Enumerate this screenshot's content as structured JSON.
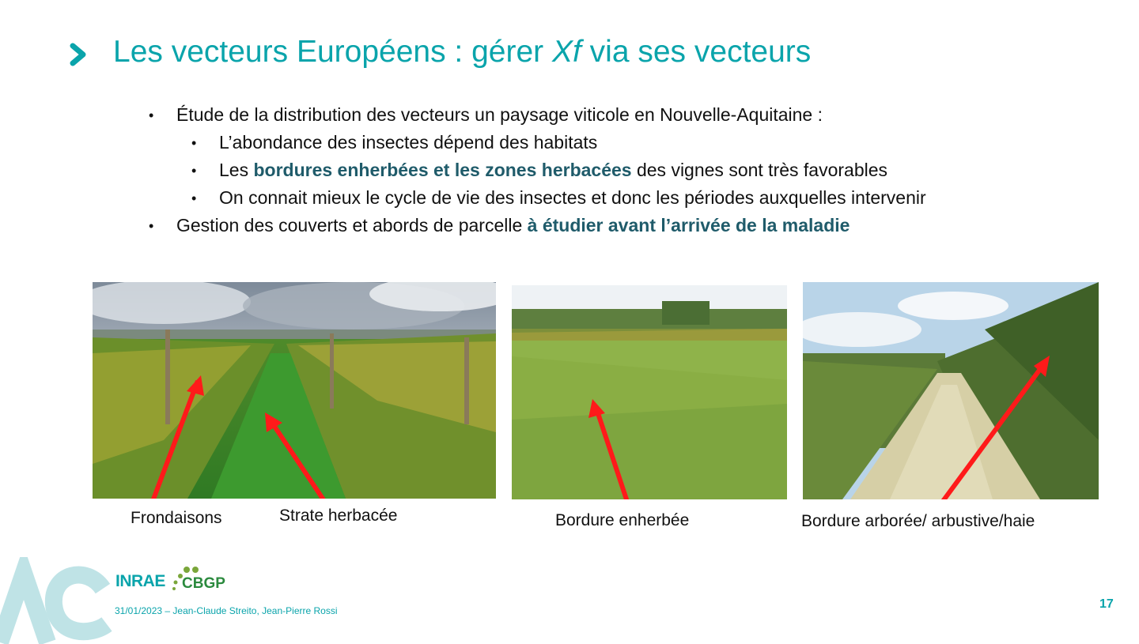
{
  "slide": {
    "title_pre": "Les vecteurs Européens : gérer ",
    "title_italic": "Xf",
    "title_post": " via ses vecteurs",
    "bullets": {
      "b1": "Étude de la distribution des vecteurs un paysage viticole en Nouvelle-Aquitaine :",
      "b1_1": "L’abondance des insectes dépend des habitats",
      "b1_2_pre": "Les ",
      "b1_2_hl": "bordures enherbées et les zones herbacées",
      "b1_2_post": " des vignes sont très favorables",
      "b1_3": "On connait mieux le cycle de vie des insectes et donc les périodes auxquelles intervenir",
      "b2_pre": "Gestion des couverts et abords de parcelle ",
      "b2_hl": "à étudier avant l’arrivée de la maladie"
    },
    "captions": {
      "c1": "Frondaisons",
      "c2": "Strate herbacée",
      "c3": "Bordure enherbée",
      "c4": "Bordure arborée/ arbustive/haie"
    },
    "footer": {
      "text": "31/01/2023 – Jean-Claude Streito, Jean-Pierre Rossi",
      "page_number": "17",
      "logo_inrae": "INRAE",
      "logo_cbgp": "CBGP"
    },
    "colors": {
      "accent": "#0aa4ab",
      "highlight": "#1f5b6a",
      "arrow": "#ff1a1a"
    }
  }
}
